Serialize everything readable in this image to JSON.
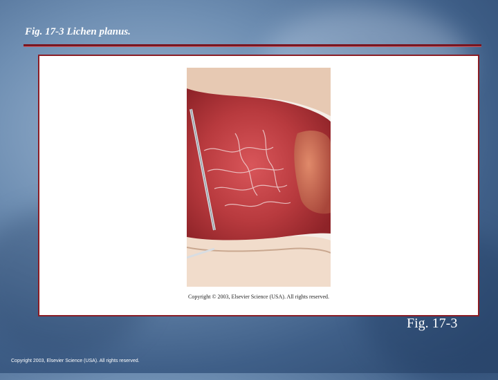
{
  "slide": {
    "title": "Fig. 17-3  Lichen planus.",
    "figure_label": "Fig. 17-3",
    "footer_copyright": "Copyright 2003, Elsevier Science (USA). All rights reserved."
  },
  "figure": {
    "caption": "Copyright © 2003, Elsevier Science (USA). All rights reserved."
  },
  "colors": {
    "accent_rule": "#7a1620",
    "frame_border": "#8a1c24"
  }
}
